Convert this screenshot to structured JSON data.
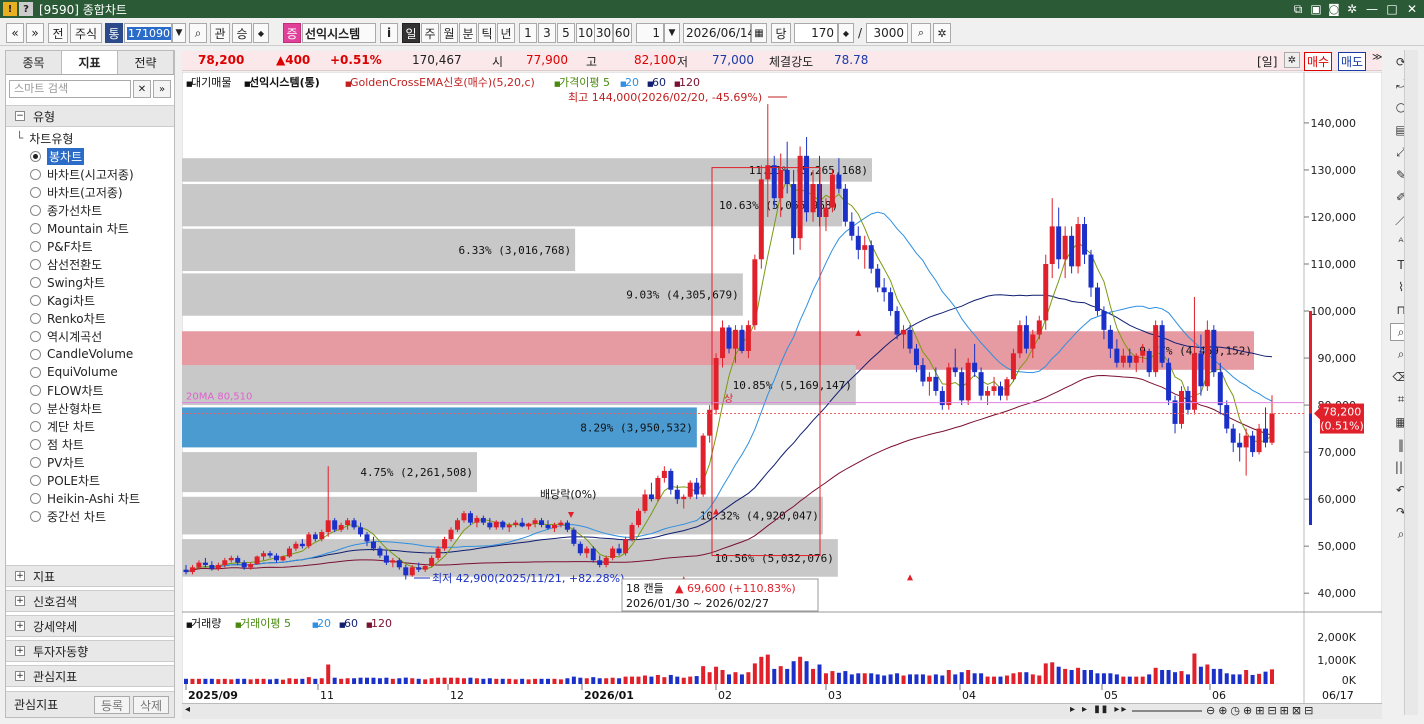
{
  "window": {
    "code": "[9590]",
    "title": "종합차트"
  },
  "toolbar": {
    "nav_prev": "«",
    "nav_down": "»",
    "jeon": "전",
    "stock": "주식",
    "tong": "통",
    "code_value": "171090",
    "gwan": "관",
    "seung": "승",
    "jeung": "증",
    "stock_name": "선익시스템",
    "info": "i",
    "periods": [
      "일",
      "주",
      "월",
      "분",
      "틱",
      "년"
    ],
    "minutes": [
      "1",
      "3",
      "5",
      "10",
      "30",
      "60"
    ],
    "period_count": "1",
    "date": "2026/06/14",
    "dang": "당",
    "count": "170",
    "slash": "/",
    "total": "3000"
  },
  "sidebar": {
    "tabs": [
      "종목",
      "지표",
      "전략"
    ],
    "search_placeholder": "스마트 검색",
    "group_type": "유형",
    "tree_root": "차트유형",
    "items": [
      "봉차트",
      "바차트(시고저종)",
      "바차트(고저종)",
      "종가선차트",
      "Mountain 차트",
      "P&F차트",
      "삼선전환도",
      "Swing차트",
      "Kagi차트",
      "Renko차트",
      "역시계곡선",
      "CandleVolume",
      "EquiVolume",
      "FLOW차트",
      "분산형차트",
      "계단 차트",
      "점 차트",
      "PV차트",
      "POLE차트",
      "Heikin-Ashi 차트",
      "중간선 차트"
    ],
    "selected_index": 0,
    "groups": [
      "지표",
      "신호검색",
      "강세약세",
      "투자자동향",
      "관심지표"
    ],
    "footer_label": "관심지표",
    "footer_register": "등록",
    "footer_delete": "삭제"
  },
  "quote": {
    "price": "78,200",
    "change": "▲400",
    "pct": "+0.51%",
    "volume": "170,467",
    "open_label": "시",
    "open": "77,900",
    "high_label": "고",
    "high": "82,100",
    "low_label": "저",
    "low": "77,000",
    "strength_label": "체결강도",
    "strength": "78.78",
    "period_tag": "[일]",
    "buy": "매수",
    "sell": "매도"
  },
  "chart_data": [
    {
      "type": "candlestick",
      "legend": [
        "대기매물",
        "선익시스템(통)",
        "GoldenCrossEMA신호(매수)(5,20,c)",
        "가격이평 5",
        "20",
        "60",
        "120"
      ],
      "y_ticks": [
        "140,000",
        "130,000",
        "120,000",
        "110,000",
        "100,000",
        "90,000",
        "80,000",
        "70,000",
        "60,000",
        "50,000",
        "40,000"
      ],
      "ylim": [
        36000,
        147000
      ],
      "x_labels": [
        "2025/09",
        "11",
        "12",
        "2026/01",
        "02",
        "03",
        "04",
        "05",
        "06",
        "06/17"
      ],
      "current_price": "78,200",
      "current_pct": "(0.51%)",
      "ma20_label": "20MA 80,510",
      "annotations": {
        "high": "최고 144,000(2026/02/20, -45.69%)",
        "low": "최저 42,900(2025/11/21, +82.28%)",
        "dividend": "배당락(0%)",
        "sig": "상",
        "range_count": "18 캔들",
        "range_change": "▲ 69,600 (+110.83%)",
        "range_dates": "2026/01/30 ~ 2026/02/27"
      },
      "volume_profile": [
        {
          "label": "11.11% (5,265,168)",
          "pct": 11.11,
          "lo": 127500,
          "hi": 132500
        },
        {
          "label": "10.63% (5,066,968)",
          "pct": 10.63,
          "lo": 118000,
          "hi": 127000
        },
        {
          "label": "6.33% (3,016,768)",
          "pct": 6.33,
          "lo": 108500,
          "hi": 117500
        },
        {
          "label": "9.03% (4,305,679)",
          "pct": 9.03,
          "lo": 99000,
          "hi": 108000
        },
        {
          "label": "9.77% (4,469,152)",
          "pct": 9.77,
          "lo": 87500,
          "hi": 95700,
          "highlight": "pink"
        },
        {
          "label": "10.85% (5,169,147)",
          "pct": 10.85,
          "lo": 80000,
          "hi": 88500
        },
        {
          "label": "8.29% (3,950,532)",
          "pct": 8.29,
          "lo": 71000,
          "hi": 79500,
          "highlight": "blue"
        },
        {
          "label": "4.75% (2,261,508)",
          "pct": 4.75,
          "lo": 61500,
          "hi": 70000
        },
        {
          "label": "10.32% (4,920,047)",
          "pct": 10.32,
          "lo": 52500,
          "hi": 60500
        },
        {
          "label": "10.56% (5,032,076)",
          "pct": 10.56,
          "lo": 43500,
          "hi": 51500
        }
      ],
      "candles": [
        [
          45,
          46,
          44,
          44.5
        ],
        [
          44.5,
          46,
          44,
          45.5
        ],
        [
          45.5,
          47,
          45,
          46.5
        ],
        [
          46.5,
          47.5,
          45.5,
          46
        ],
        [
          46,
          46.8,
          44.8,
          45.2
        ],
        [
          45.2,
          46.5,
          44.8,
          46
        ],
        [
          46,
          47.5,
          45.5,
          47
        ],
        [
          47,
          48,
          46.5,
          47.5
        ],
        [
          47.5,
          48,
          46,
          46.5
        ],
        [
          46.5,
          47,
          45,
          45.5
        ],
        [
          45.5,
          46.5,
          45,
          46.2
        ],
        [
          46.2,
          48,
          46,
          47.8
        ],
        [
          47.8,
          49,
          47,
          48.5
        ],
        [
          48.5,
          49,
          47.5,
          48
        ],
        [
          48,
          48.5,
          46.5,
          47
        ],
        [
          47,
          48,
          46.8,
          47.8
        ],
        [
          47.8,
          50,
          47.5,
          49.5
        ],
        [
          49.5,
          51,
          49,
          50.5
        ],
        [
          50.5,
          51.5,
          49.5,
          50
        ],
        [
          50,
          53,
          49.5,
          52.5
        ],
        [
          52.5,
          53,
          51,
          51.5
        ],
        [
          51.5,
          53.5,
          51,
          53
        ],
        [
          53,
          67,
          52,
          55.5
        ],
        [
          55.5,
          56,
          53,
          53.5
        ],
        [
          53.5,
          55,
          53,
          54.5
        ],
        [
          54.5,
          56,
          53.5,
          55.5
        ],
        [
          55.5,
          56,
          53.5,
          54
        ],
        [
          54,
          55,
          52,
          52.5
        ],
        [
          52.5,
          53,
          50,
          51
        ],
        [
          51,
          52,
          49,
          49.5
        ],
        [
          49.5,
          50,
          47.5,
          48
        ],
        [
          48,
          49,
          46,
          46.5
        ],
        [
          46.5,
          47.5,
          45.5,
          47
        ],
        [
          47,
          47.5,
          45,
          45.5
        ],
        [
          45.5,
          46,
          42.9,
          43.8
        ],
        [
          43.8,
          46,
          43.5,
          45.5
        ],
        [
          45.5,
          46.5,
          44.5,
          45
        ],
        [
          45,
          46,
          44.5,
          45.8
        ],
        [
          45.8,
          48,
          45.5,
          47.5
        ],
        [
          47.5,
          50,
          47,
          49.5
        ],
        [
          49.5,
          52,
          49,
          51.5
        ],
        [
          51.5,
          54,
          51,
          53.5
        ],
        [
          53.5,
          56,
          53,
          55.5
        ],
        [
          55.5,
          57.5,
          55,
          57
        ],
        [
          57,
          57.5,
          54.5,
          55
        ],
        [
          55,
          56.5,
          54,
          56
        ],
        [
          56,
          56.5,
          54.5,
          55
        ],
        [
          55,
          56,
          53.5,
          54
        ],
        [
          54,
          55.5,
          53.5,
          55.2
        ],
        [
          55.2,
          55.5,
          53.5,
          54
        ],
        [
          54,
          55,
          53,
          54.5
        ],
        [
          54.5,
          55.5,
          54,
          55
        ],
        [
          55,
          56,
          54,
          54.2
        ],
        [
          54.2,
          55,
          53.5,
          54.8
        ],
        [
          54.8,
          56,
          54,
          55.5
        ],
        [
          55.5,
          56,
          54,
          54.5
        ],
        [
          54.5,
          55.5,
          53.5,
          53.8
        ],
        [
          53.8,
          55,
          53,
          54.5
        ],
        [
          54.5,
          55.5,
          54,
          55
        ],
        [
          55,
          55.5,
          53,
          53.5
        ],
        [
          53.5,
          54,
          50,
          50.5
        ],
        [
          50.5,
          51,
          48,
          48.5
        ],
        [
          48.5,
          50,
          47.5,
          49.5
        ],
        [
          49.5,
          50,
          46.5,
          47
        ],
        [
          47,
          48,
          45.5,
          46
        ],
        [
          46,
          48,
          45.5,
          47.5
        ],
        [
          47.5,
          50,
          47,
          49.5
        ],
        [
          49.5,
          50.5,
          48,
          48.5
        ],
        [
          48.5,
          52,
          48,
          51.5
        ],
        [
          51.5,
          55,
          51,
          54.5
        ],
        [
          54.5,
          58,
          54,
          57.5
        ],
        [
          57.5,
          62,
          57,
          61
        ],
        [
          61,
          63.5,
          59.5,
          60
        ],
        [
          60,
          65,
          59.5,
          64.5
        ],
        [
          64.5,
          67,
          63.5,
          66
        ],
        [
          66,
          66.5,
          61,
          62
        ],
        [
          62,
          63,
          59,
          60
        ],
        [
          60,
          61,
          58,
          60.5
        ],
        [
          60.5,
          64,
          60,
          63.5
        ],
        [
          63.5,
          64.5,
          60,
          61
        ],
        [
          61,
          74,
          60.5,
          73.5
        ],
        [
          73.5,
          80,
          72,
          79
        ],
        [
          79,
          91,
          78,
          90
        ],
        [
          90,
          98,
          88,
          96.5
        ],
        [
          96.5,
          97,
          91,
          92
        ],
        [
          92,
          97,
          89,
          96
        ],
        [
          96,
          97,
          91,
          91.5
        ],
        [
          91.5,
          98,
          90,
          97
        ],
        [
          97,
          112,
          96,
          111
        ],
        [
          111,
          131,
          109,
          128
        ],
        [
          128,
          144,
          120,
          131
        ],
        [
          131,
          133,
          122,
          124
        ],
        [
          124,
          133.5,
          120,
          130
        ],
        [
          130,
          136,
          125,
          127
        ],
        [
          127,
          130,
          112,
          115.5
        ],
        [
          115.5,
          135,
          113,
          133
        ],
        [
          133,
          137,
          119,
          121
        ],
        [
          121,
          130,
          119,
          127
        ],
        [
          127,
          133,
          118,
          120
        ],
        [
          120,
          124,
          117,
          122
        ],
        [
          122,
          130,
          121,
          129
        ],
        [
          129,
          132.5,
          125,
          126
        ],
        [
          126,
          127,
          118,
          119
        ],
        [
          119,
          121,
          115,
          116
        ],
        [
          116,
          118,
          111,
          113
        ],
        [
          113,
          116,
          109,
          114
        ],
        [
          114,
          115,
          108,
          109
        ],
        [
          109,
          110,
          104,
          105
        ],
        [
          105,
          107,
          102,
          104
        ],
        [
          104,
          105,
          99,
          100
        ],
        [
          100,
          101,
          94,
          95
        ],
        [
          95,
          97,
          92,
          96
        ],
        [
          96,
          97,
          91,
          92
        ],
        [
          92,
          93,
          87,
          88.5
        ],
        [
          88.5,
          90,
          84,
          85
        ],
        [
          85,
          87,
          82,
          86
        ],
        [
          86,
          88,
          82,
          83
        ],
        [
          83,
          84,
          79,
          80
        ],
        [
          80,
          89,
          79,
          88
        ],
        [
          88,
          92,
          86,
          87
        ],
        [
          87,
          88,
          80,
          81
        ],
        [
          81,
          90,
          80,
          89
        ],
        [
          89,
          93,
          86,
          87
        ],
        [
          87,
          88,
          81,
          82
        ],
        [
          82,
          84,
          80,
          83
        ],
        [
          83,
          86,
          82,
          84
        ],
        [
          84,
          85,
          81,
          82
        ],
        [
          82,
          86,
          81,
          85.5
        ],
        [
          85.5,
          92,
          85,
          91
        ],
        [
          91,
          98,
          90,
          97
        ],
        [
          97,
          99,
          91,
          92
        ],
        [
          92,
          96,
          90,
          95
        ],
        [
          95,
          99,
          94,
          98
        ],
        [
          98,
          112,
          96,
          110
        ],
        [
          110,
          124,
          107,
          118
        ],
        [
          118,
          122,
          109,
          111
        ],
        [
          111,
          118,
          107,
          116
        ],
        [
          116,
          118,
          108,
          109.5
        ],
        [
          109.5,
          120,
          108,
          118.5
        ],
        [
          118.5,
          120,
          110,
          112
        ],
        [
          112,
          113,
          103,
          105
        ],
        [
          105,
          106,
          99,
          100
        ],
        [
          100,
          101,
          94,
          96
        ],
        [
          96,
          97,
          90,
          92
        ],
        [
          92,
          94,
          88,
          89
        ],
        [
          89,
          92,
          88,
          90.5
        ],
        [
          90.5,
          92,
          88,
          89
        ],
        [
          89,
          91,
          87,
          90.5
        ],
        [
          90.5,
          93,
          89,
          91.5
        ],
        [
          91.5,
          92,
          86,
          87
        ],
        [
          87,
          98,
          86,
          97
        ],
        [
          97,
          98,
          88,
          89
        ],
        [
          89,
          90,
          80,
          81
        ],
        [
          81,
          82,
          74,
          76
        ],
        [
          76,
          84,
          75,
          83
        ],
        [
          83,
          84,
          78,
          79
        ],
        [
          79,
          103,
          78,
          91
        ],
        [
          91,
          95,
          82,
          84
        ],
        [
          84,
          98,
          83,
          96
        ],
        [
          96,
          97,
          86,
          87
        ],
        [
          87,
          89,
          78,
          80
        ],
        [
          80,
          81,
          74,
          75
        ],
        [
          75,
          76,
          70,
          72
        ],
        [
          72,
          74,
          68,
          71
        ],
        [
          71,
          75,
          65,
          73.5
        ],
        [
          73.5,
          74.5,
          69,
          70
        ],
        [
          70,
          76,
          69.5,
          75
        ],
        [
          75,
          79.5,
          71,
          72
        ],
        [
          72,
          82.1,
          71.5,
          78.2
        ]
      ],
      "vol_ticks": [
        "2,000K",
        "1,000K",
        "0K"
      ],
      "vol_legend": [
        "거래량",
        "거래이평 5",
        "20",
        "60",
        "120"
      ]
    }
  ],
  "status_bar": {
    "scroll_left": "◂",
    "scroll_right": "▸"
  }
}
